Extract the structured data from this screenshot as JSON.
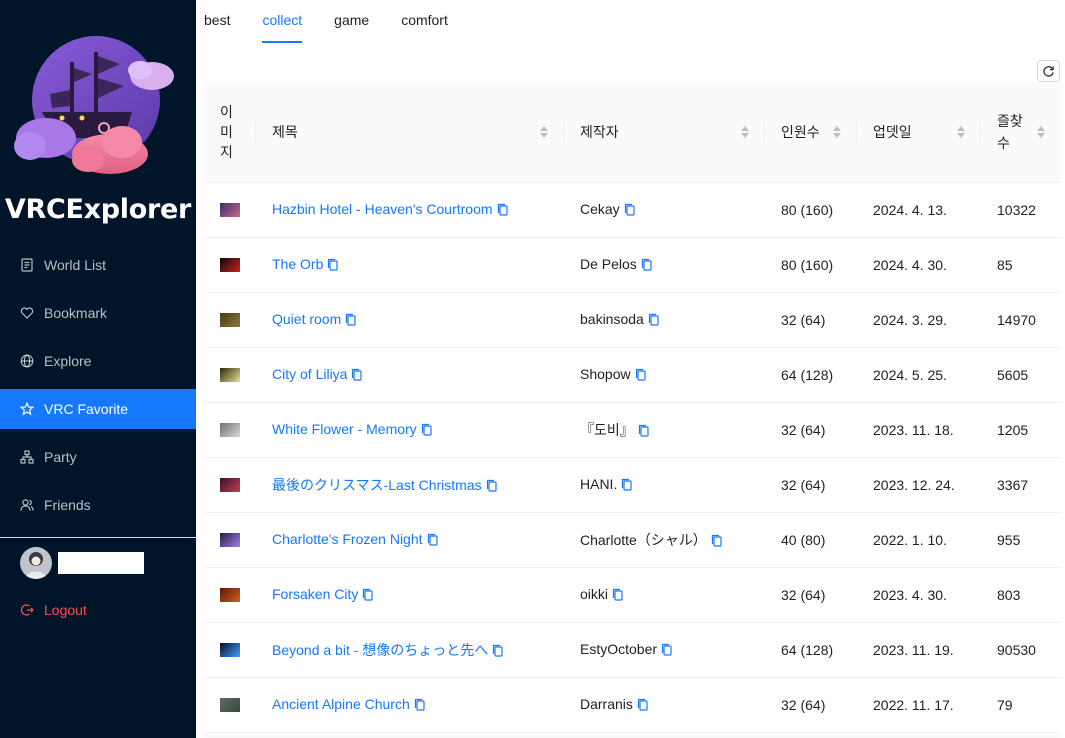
{
  "app": {
    "title": "VRCExplorer"
  },
  "sidebar": {
    "items": [
      {
        "label": "World List",
        "icon": "file-list-icon",
        "active": false
      },
      {
        "label": "Bookmark",
        "icon": "heart-icon",
        "active": false
      },
      {
        "label": "Explore",
        "icon": "globe-icon",
        "active": false
      },
      {
        "label": "VRC Favorite",
        "icon": "star-icon",
        "active": true
      },
      {
        "label": "Party",
        "icon": "cluster-icon",
        "active": false
      },
      {
        "label": "Friends",
        "icon": "users-icon",
        "active": false
      }
    ],
    "logout_label": "Logout"
  },
  "tabs": [
    {
      "label": "best",
      "active": false
    },
    {
      "label": "collect",
      "active": true
    },
    {
      "label": "game",
      "active": false
    },
    {
      "label": "comfort",
      "active": false
    }
  ],
  "table": {
    "columns": {
      "image": "이미지",
      "image_chars": [
        "이",
        "미",
        "지"
      ],
      "title": "제목",
      "author": "제작자",
      "capacity": "인원수",
      "updated": "업뎃일",
      "visits": "즐찾수",
      "visits_lines": [
        "즐찾",
        "수"
      ]
    },
    "rows": [
      {
        "title": "Hazbin Hotel - Heaven's Courtroom",
        "author": "Cekay",
        "capacity": "80 (160)",
        "updated": "2024. 4. 13.",
        "visits": "10322",
        "thumb_colors": [
          "#3a2e6e",
          "#c86a8a"
        ]
      },
      {
        "title": "The Orb",
        "author": "De Pelos",
        "capacity": "80 (160)",
        "updated": "2024. 4. 30.",
        "visits": "85",
        "thumb_colors": [
          "#0a0a0a",
          "#d02020"
        ]
      },
      {
        "title": "Quiet room",
        "author": "bakinsoda",
        "capacity": "32 (64)",
        "updated": "2024. 3. 29.",
        "visits": "14970",
        "thumb_colors": [
          "#4a3a1a",
          "#8a7a3a"
        ]
      },
      {
        "title": "City of Liliya",
        "author": "Shopow",
        "capacity": "64 (128)",
        "updated": "2024. 5. 25.",
        "visits": "5605",
        "thumb_colors": [
          "#2a2a10",
          "#e8e090"
        ]
      },
      {
        "title": "White Flower - Memory",
        "author": "『도비』",
        "capacity": "32 (64)",
        "updated": "2023. 11. 18.",
        "visits": "1205",
        "thumb_colors": [
          "#707070",
          "#d8d8d8"
        ]
      },
      {
        "title": "最後のクリスマス-Last Christmas",
        "author": "HANI.",
        "capacity": "32 (64)",
        "updated": "2023. 12. 24.",
        "visits": "3367",
        "thumb_colors": [
          "#3a1030",
          "#c04050"
        ]
      },
      {
        "title": "Charlotte's Frozen Night",
        "author": "Charlotte（シャル）",
        "capacity": "40 (80)",
        "updated": "2022. 1. 10.",
        "visits": "955",
        "thumb_colors": [
          "#20204a",
          "#a080e0"
        ]
      },
      {
        "title": "Forsaken City",
        "author": "oikki",
        "capacity": "32 (64)",
        "updated": "2023. 4. 30.",
        "visits": "803",
        "thumb_colors": [
          "#5a1a08",
          "#d06020"
        ]
      },
      {
        "title": "Beyond a bit - 想像のちょっと先へ",
        "author": "EstyOctober",
        "capacity": "64 (128)",
        "updated": "2023. 11. 19.",
        "visits": "90530",
        "thumb_colors": [
          "#081030",
          "#40a0ff"
        ]
      },
      {
        "title": "Ancient Alpine Church",
        "author": "Darranis",
        "capacity": "32 (64)",
        "updated": "2022. 11. 17.",
        "visits": "79",
        "thumb_colors": [
          "#5a6a70",
          "#3a4a30"
        ]
      }
    ]
  },
  "colors": {
    "sidebar_bg": "#001529",
    "accent": "#1677ff",
    "danger": "#ff4d4f"
  }
}
